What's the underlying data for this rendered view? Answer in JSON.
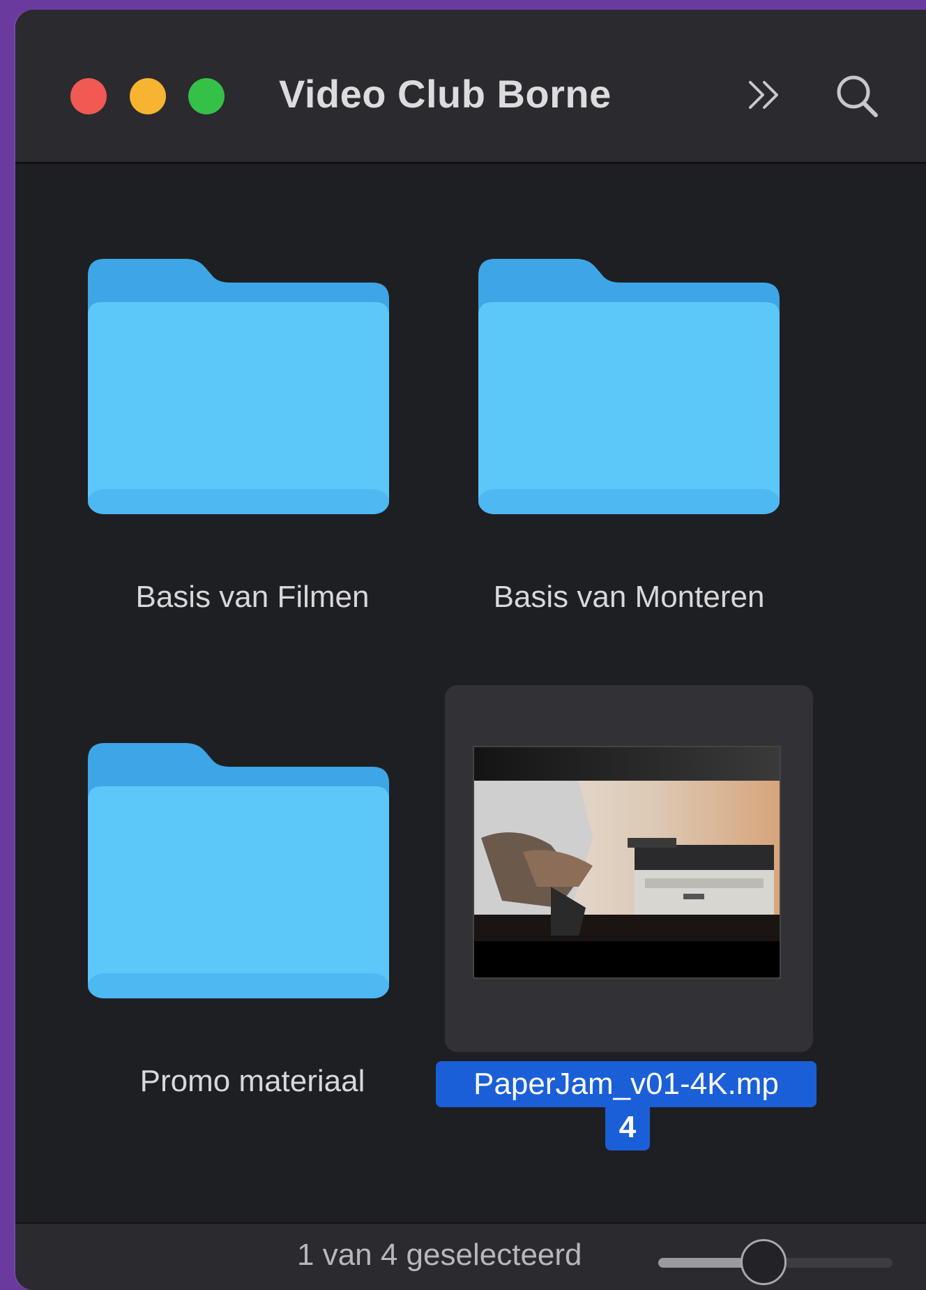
{
  "window": {
    "title": "Video Club Borne"
  },
  "toolbar": {
    "more_icon": "chevrons-right-icon",
    "search_icon": "search-icon"
  },
  "items": [
    {
      "name": "Basis van Filmen",
      "kind": "folder",
      "selected": false
    },
    {
      "name": "Basis van Monteren",
      "kind": "folder",
      "selected": false
    },
    {
      "name": "Promo materiaal",
      "kind": "folder",
      "selected": false
    },
    {
      "name": "PaperJam_v01-4K.mp4",
      "name_line1": "PaperJam_v01-4K.mp",
      "name_line2": "4",
      "kind": "video",
      "selected": true
    }
  ],
  "status": {
    "selection_text": "1 van 4 geselecteerd",
    "icon_size_level": 0.45
  },
  "colors": {
    "folder_front": "#5cc8fa",
    "folder_back": "#3ea6e6",
    "selection": "#1b5fd8",
    "close": "#f05a52",
    "minimize": "#f7b430",
    "zoom": "#35c048"
  }
}
